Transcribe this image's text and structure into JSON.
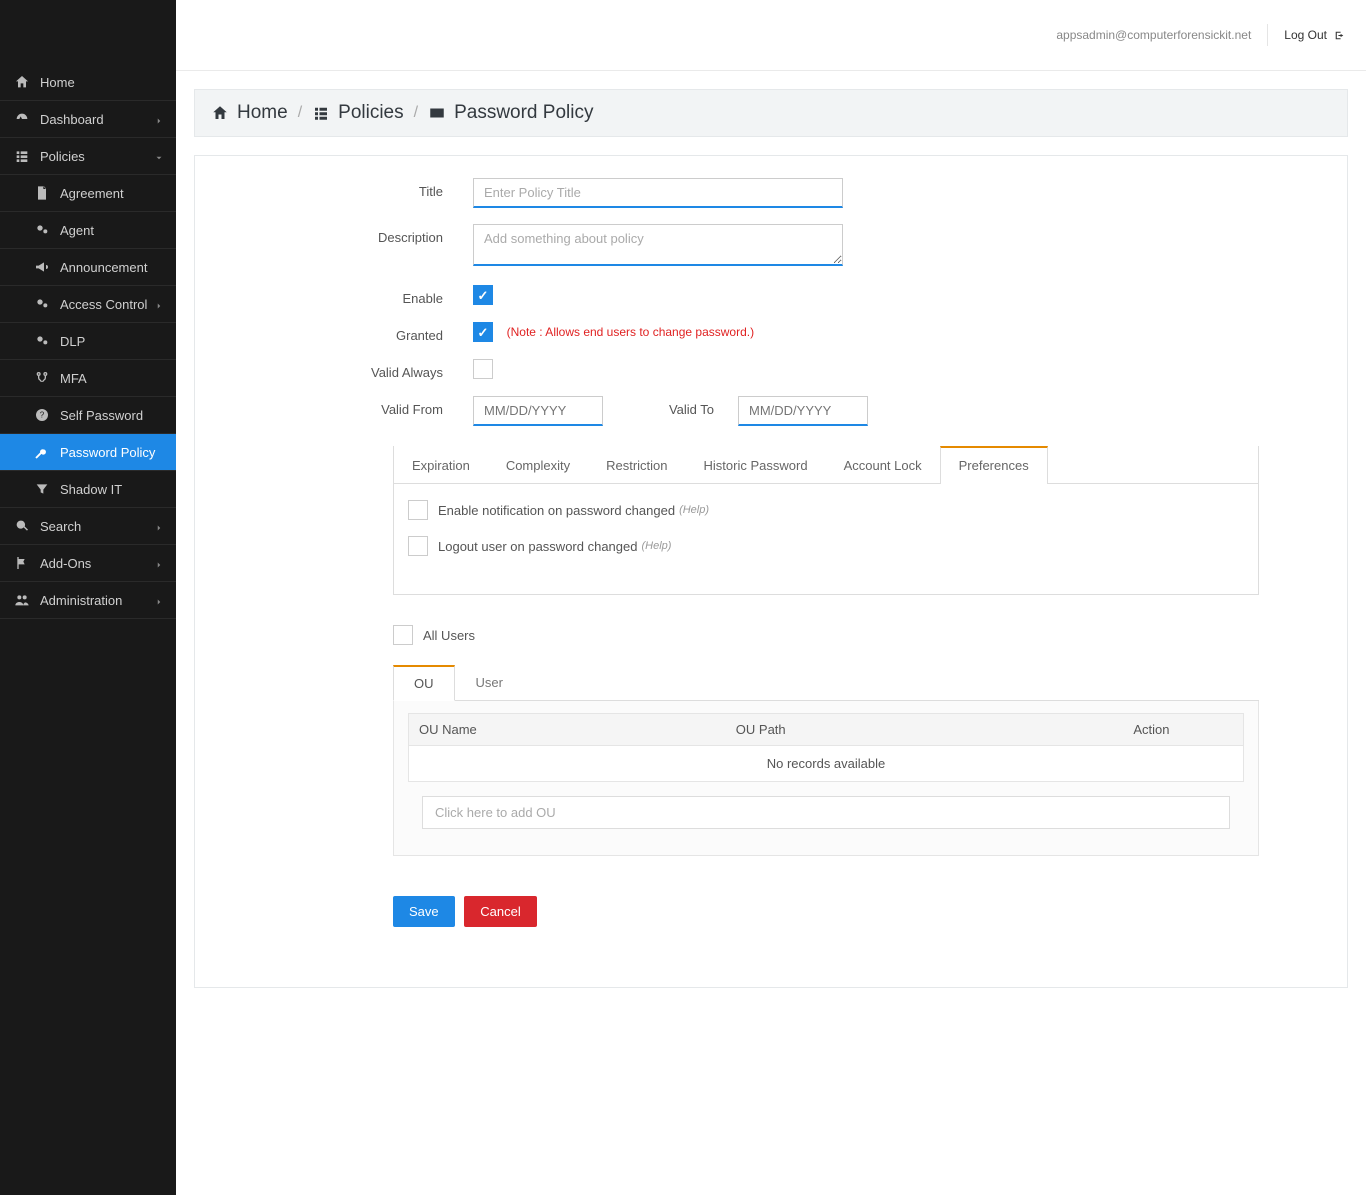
{
  "topbar": {
    "user_email": "appsadmin@computerforensickit.net",
    "logout_label": "Log Out"
  },
  "breadcrumb": {
    "home": "Home",
    "policies": "Policies",
    "current": "Password Policy"
  },
  "sidebar": {
    "home": "Home",
    "dashboard": "Dashboard",
    "policies": "Policies",
    "agreement": "Agreement",
    "agent": "Agent",
    "announcement": "Announcement",
    "access_control": "Access Control",
    "dlp": "DLP",
    "mfa": "MFA",
    "self_password": "Self Password",
    "password_policy": "Password Policy",
    "shadow_it": "Shadow IT",
    "search": "Search",
    "addons": "Add-Ons",
    "administration": "Administration"
  },
  "form": {
    "title_label": "Title",
    "title_placeholder": "Enter Policy Title",
    "description_label": "Description",
    "description_placeholder": "Add something about policy",
    "enable_label": "Enable",
    "granted_label": "Granted",
    "granted_note": "(Note : Allows end users to change password.)",
    "valid_always_label": "Valid Always",
    "valid_from_label": "Valid From",
    "valid_to_label": "Valid To",
    "date_placeholder": "MM/DD/YYYY"
  },
  "tabs": {
    "expiration": "Expiration",
    "complexity": "Complexity",
    "restriction": "Restriction",
    "historic": "Historic Password",
    "account_lock": "Account Lock",
    "preferences": "Preferences"
  },
  "preferences": {
    "notify_label": "Enable notification on password changed",
    "logout_label": "Logout user on password changed",
    "help": "(Help)"
  },
  "allusers_label": "All Users",
  "ou_tabs": {
    "ou": "OU",
    "user": "User"
  },
  "ou_table": {
    "col_name": "OU Name",
    "col_path": "OU Path",
    "col_action": "Action",
    "empty": "No records available",
    "add_placeholder": "Click here to add OU"
  },
  "buttons": {
    "save": "Save",
    "cancel": "Cancel"
  }
}
